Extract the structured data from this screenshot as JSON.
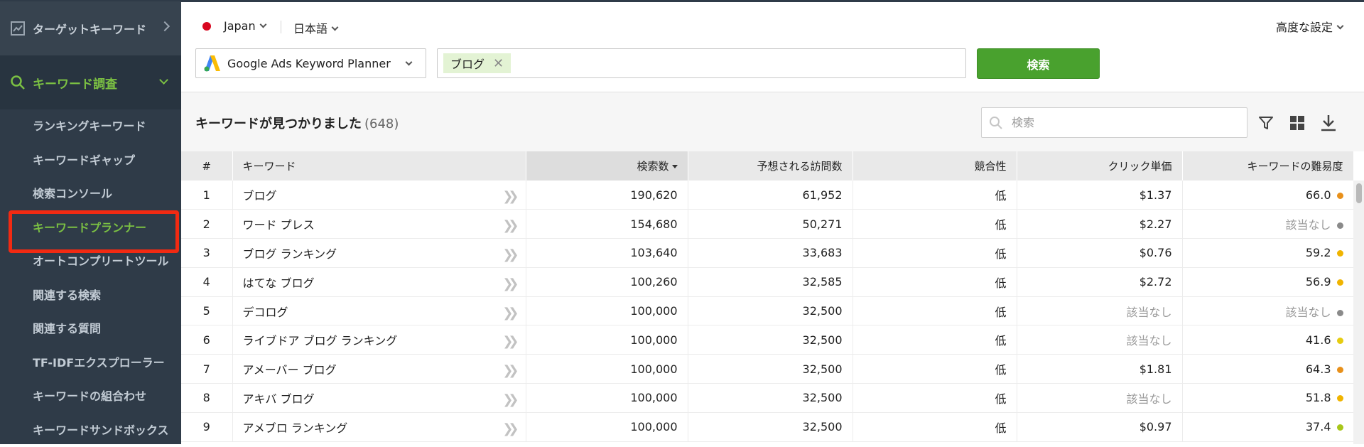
{
  "sidebar": {
    "target_label": "ターゲットキーワード",
    "research_label": "キーワード調査",
    "items": [
      {
        "label": "ランキングキーワード"
      },
      {
        "label": "キーワードギャップ"
      },
      {
        "label": "検索コンソール"
      },
      {
        "label": "キーワードプランナー",
        "active": true
      },
      {
        "label": "オートコンプリートツール"
      },
      {
        "label": "関連する検索"
      },
      {
        "label": "関連する質問"
      },
      {
        "label": "TF-IDFエクスプローラー"
      },
      {
        "label": "キーワードの組合わせ"
      },
      {
        "label": "キーワードサンドボックス"
      }
    ]
  },
  "topbar": {
    "country": "Japan",
    "language": "日本語",
    "advanced": "高度な設定",
    "source": "Google Ads Keyword Planner",
    "keyword_tag": "ブログ",
    "search_button": "検索"
  },
  "results": {
    "title": "キーワードが見つかりました",
    "count": "(648)",
    "filter_placeholder": "検索"
  },
  "table": {
    "headers": {
      "num": "#",
      "keyword": "キーワード",
      "volume": "検索数",
      "visits": "予想される訪問数",
      "competition": "競合性",
      "cpc": "クリック単価",
      "difficulty": "キーワードの難易度"
    },
    "rows": [
      {
        "num": "1",
        "keyword": "ブログ",
        "volume": "190,620",
        "visits": "61,952",
        "competition": "低",
        "cpc": "$1.37",
        "difficulty": "66.0",
        "dot_color": "#e8901a"
      },
      {
        "num": "2",
        "keyword": "ワード プレス",
        "volume": "154,680",
        "visits": "50,271",
        "competition": "低",
        "cpc": "$2.27",
        "difficulty": "該当なし",
        "dot_color": "#8a8a8a"
      },
      {
        "num": "3",
        "keyword": "ブログ ランキング",
        "volume": "103,640",
        "visits": "33,683",
        "competition": "低",
        "cpc": "$0.76",
        "difficulty": "59.2",
        "dot_color": "#f0b400"
      },
      {
        "num": "4",
        "keyword": "はてな ブログ",
        "volume": "100,260",
        "visits": "32,585",
        "competition": "低",
        "cpc": "$2.72",
        "difficulty": "56.9",
        "dot_color": "#f0b400"
      },
      {
        "num": "5",
        "keyword": "デコログ",
        "volume": "100,000",
        "visits": "32,500",
        "competition": "低",
        "cpc": "該当なし",
        "difficulty": "該当なし",
        "dot_color": "#8a8a8a"
      },
      {
        "num": "6",
        "keyword": "ライブドア ブログ ランキング",
        "volume": "100,000",
        "visits": "32,500",
        "competition": "低",
        "cpc": "該当なし",
        "difficulty": "41.6",
        "dot_color": "#e6cc10"
      },
      {
        "num": "7",
        "keyword": "アメーバー ブログ",
        "volume": "100,000",
        "visits": "32,500",
        "competition": "低",
        "cpc": "$1.81",
        "difficulty": "64.3",
        "dot_color": "#e8901a"
      },
      {
        "num": "8",
        "keyword": "アキバ ブログ",
        "volume": "100,000",
        "visits": "32,500",
        "competition": "低",
        "cpc": "該当なし",
        "difficulty": "51.8",
        "dot_color": "#f0b400"
      },
      {
        "num": "9",
        "keyword": "アメブロ ランキング",
        "volume": "100,000",
        "visits": "32,500",
        "competition": "低",
        "cpc": "$0.97",
        "difficulty": "37.4",
        "dot_color": "#a8c61a"
      }
    ]
  },
  "colors": {
    "sidebar_bg": "#2f3b48",
    "accent_green": "#7bc043",
    "button_green": "#49a12e",
    "highlight_red": "#f22a12"
  }
}
